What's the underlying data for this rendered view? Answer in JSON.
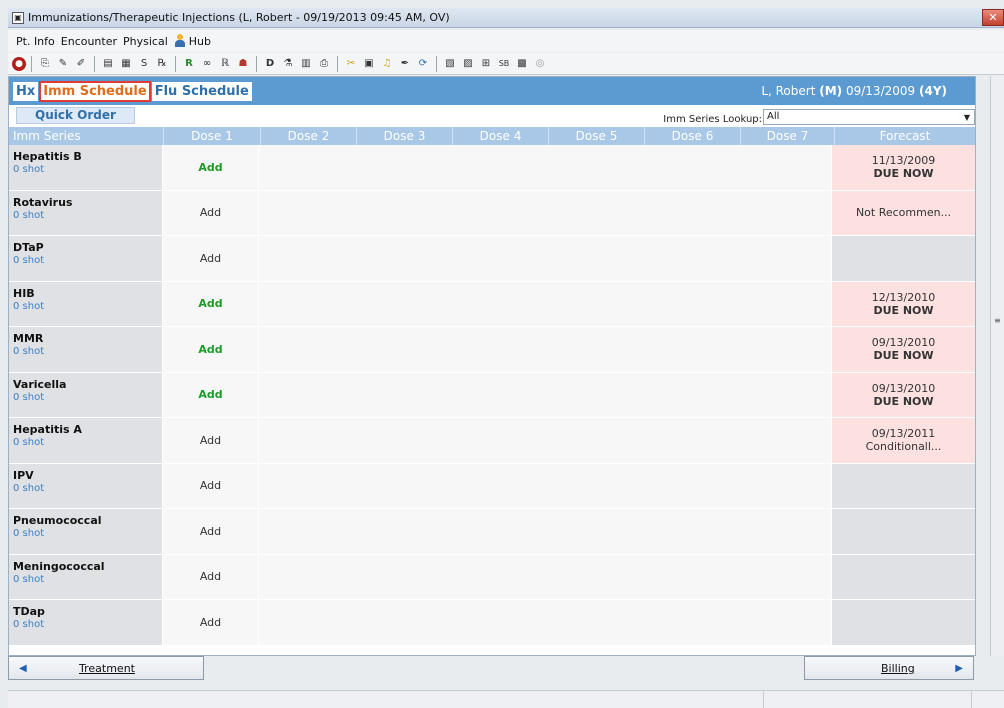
{
  "window": {
    "title": "Immunizations/Therapeutic Injections (L, Robert  - 09/19/2013 09:45 AM, OV)",
    "close_label": "✕"
  },
  "menu": [
    "Pt. Info",
    "Encounter",
    "Physical",
    "Hub"
  ],
  "toolbar": {
    "icons": [
      "stop-icon",
      "copy-icon",
      "pencil-icon",
      "edit-icon",
      "notes-icon",
      "chart-icon",
      "s-icon",
      "rx-icon",
      "r-icon",
      "glasses-icon",
      "re-icon",
      "doctor-icon",
      "dx-icon",
      "lab-icon",
      "grid-icon",
      "print-icon",
      "tools-icon",
      "binder-icon",
      "bell-icon",
      "pen-icon",
      "refresh-icon",
      "doc-icon",
      "compare-icon",
      "flow-icon",
      "sb-icon",
      "book-icon",
      "globe-icon"
    ]
  },
  "tabs": {
    "hx": "Hx",
    "imm_schedule": "Imm Schedule",
    "flu_schedule": "Flu Schedule"
  },
  "patient": {
    "name": "L, Robert",
    "sex": "(M)",
    "dob": "09/13/2009",
    "age": "(4Y)"
  },
  "quick_order": "Quick Order",
  "lookup": {
    "label": "Imm Series Lookup:",
    "value": "All"
  },
  "columns": [
    "Imm Series",
    "Dose 1",
    "Dose 2",
    "Dose 3",
    "Dose 4",
    "Dose 5",
    "Dose 6",
    "Dose 7",
    "Forecast"
  ],
  "rows": [
    {
      "name": "Hepatitis B",
      "shots": "0 shot",
      "dose1": "Add",
      "dose1_style": "green",
      "forecast_date": "11/13/2009",
      "forecast_status": "DUE NOW",
      "forecast_style": "due"
    },
    {
      "name": "Rotavirus",
      "shots": "0 shot",
      "dose1": "Add",
      "dose1_style": "gray",
      "forecast_date": "Not Recommen...",
      "forecast_status": "",
      "forecast_style": "due"
    },
    {
      "name": "DTaP",
      "shots": "0 shot",
      "dose1": "Add",
      "dose1_style": "gray",
      "forecast_date": "",
      "forecast_status": "",
      "forecast_style": "none"
    },
    {
      "name": "HIB",
      "shots": "0 shot",
      "dose1": "Add",
      "dose1_style": "green",
      "forecast_date": "12/13/2010",
      "forecast_status": "DUE NOW",
      "forecast_style": "due"
    },
    {
      "name": "MMR",
      "shots": "0 shot",
      "dose1": "Add",
      "dose1_style": "green",
      "forecast_date": "09/13/2010",
      "forecast_status": "DUE NOW",
      "forecast_style": "due"
    },
    {
      "name": "Varicella",
      "shots": "0 shot",
      "dose1": "Add",
      "dose1_style": "green",
      "forecast_date": "09/13/2010",
      "forecast_status": "DUE NOW",
      "forecast_style": "due"
    },
    {
      "name": "Hepatitis A",
      "shots": "0 shot",
      "dose1": "Add",
      "dose1_style": "gray",
      "forecast_date": "09/13/2011",
      "forecast_status": "Conditionall...",
      "forecast_style": "due",
      "forecast_status_plain": true
    },
    {
      "name": "IPV",
      "shots": "0 shot",
      "dose1": "Add",
      "dose1_style": "gray",
      "forecast_date": "",
      "forecast_status": "",
      "forecast_style": "none"
    },
    {
      "name": "Pneumococcal",
      "shots": "0 shot",
      "dose1": "Add",
      "dose1_style": "gray",
      "forecast_date": "",
      "forecast_status": "",
      "forecast_style": "none"
    },
    {
      "name": "Meningococcal",
      "shots": "0 shot",
      "dose1": "Add",
      "dose1_style": "gray",
      "forecast_date": "",
      "forecast_status": "",
      "forecast_style": "none"
    },
    {
      "name": "TDap",
      "shots": "0 shot",
      "dose1": "Add",
      "dose1_style": "gray",
      "forecast_date": "",
      "forecast_status": "",
      "forecast_style": "none"
    }
  ],
  "footer": {
    "treatment": "Treatment",
    "billing": "Billing"
  }
}
